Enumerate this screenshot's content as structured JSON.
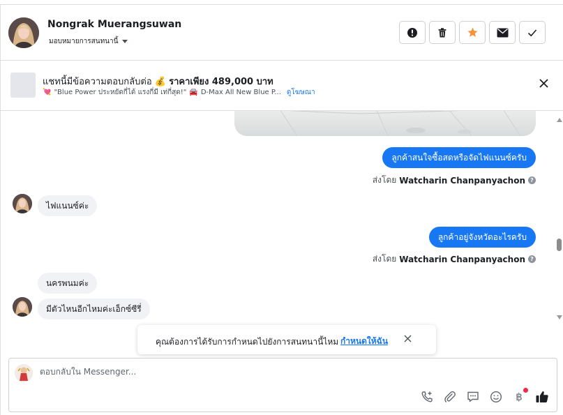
{
  "header": {
    "contact_name": "Nongrak Muerangsuwan",
    "assign_label": "มอบหมายการสนทนานี้",
    "actions": [
      "spam-icon",
      "trash-icon",
      "star-icon",
      "envelope-icon",
      "check-icon"
    ],
    "star_color": "#f7923b"
  },
  "banner": {
    "title_prefix": "แชทนี้มีข้อความตอบกลับต่อ",
    "money_emoji": "💰",
    "title_price": "ราคาเพียง 489,000 บาท",
    "sub_heart": "💘",
    "sub_text": "\"Blue Power ประหยัดกี่ได้ แรงกี่มี เท่กี่สุด!\"",
    "sub_car": "🚘",
    "sub_text2": "D-Max All New Blue P...",
    "link": "ดูโฆษณา"
  },
  "messages": {
    "out1": "ลูกค้าสนใจซื้อสดหรือจัดไฟแนนซ์ครับ",
    "sentby_prefix": "ส่งโดย",
    "sender": "Watcharin Chanpanyachon",
    "in1": "ไฟแนนซ์ค่ะ",
    "out2": "ลูกค้าอยู่จังหวัดอะไรครับ",
    "in2": "นครพนมค่ะ",
    "in3": "มีตัวไหนอีกไหมค่ะเอ็กซ์ซีรี่"
  },
  "toast": {
    "text": "คุณต้องการได้รับการกำหนดไปยังการสนทนานี้ไหม",
    "link": "กำหนดให้ฉัน"
  },
  "composer": {
    "placeholder": "ตอบกลับใน Messenger...",
    "tools": [
      "call-add-icon",
      "paperclip-icon",
      "saved-reply-icon",
      "emoji-icon",
      "baht-icon",
      "like-icon"
    ],
    "baht_symbol": "฿",
    "accent": "#1877f2"
  }
}
